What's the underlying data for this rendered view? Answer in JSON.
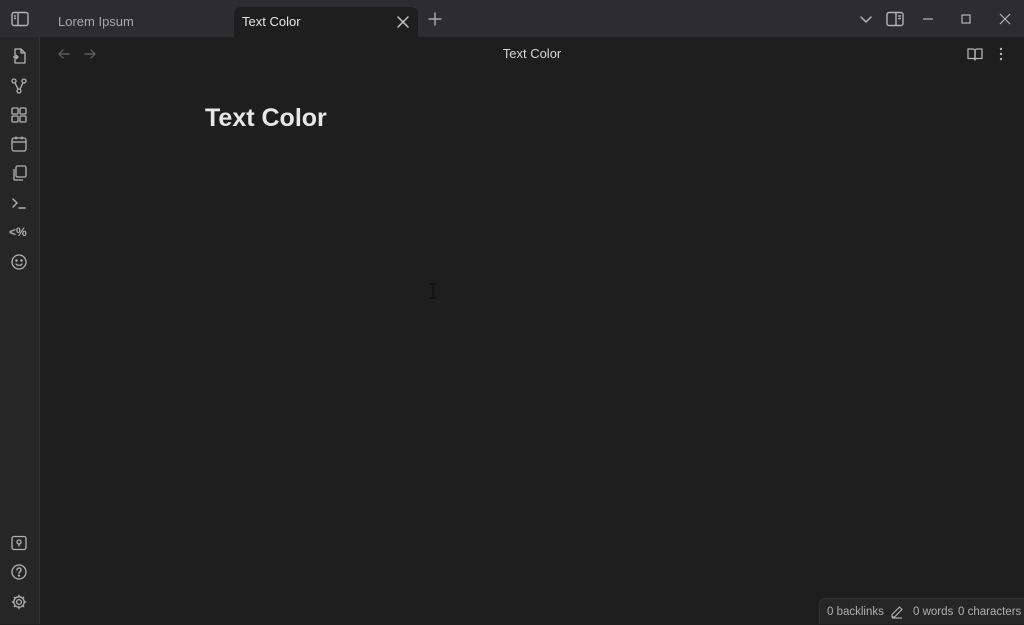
{
  "tabs": [
    {
      "label": "Lorem Ipsum",
      "active": false
    },
    {
      "label": "Text Color",
      "active": true
    }
  ],
  "view": {
    "title": "Text Color"
  },
  "note": {
    "title": "Text Color"
  },
  "ribbon": {
    "templater_label": "<%"
  },
  "status": {
    "backlinks": "0 backlinks",
    "words": "0 words",
    "characters": "0 characters"
  },
  "icons": {
    "sidebar_toggle": "sidebar-left-icon",
    "close": "close-icon",
    "plus": "plus-icon",
    "chevron": "chevron-down-icon",
    "right_sidebar": "sidebar-right-icon",
    "minimize": "minimize-icon",
    "maximize": "maximize-icon",
    "reading": "book-open-icon",
    "more": "more-vertical-icon"
  },
  "colors": {
    "background": "#1e1e1e",
    "titlebar": "#2d2d2f",
    "ribbon": "#262626",
    "text": "#dadada"
  }
}
